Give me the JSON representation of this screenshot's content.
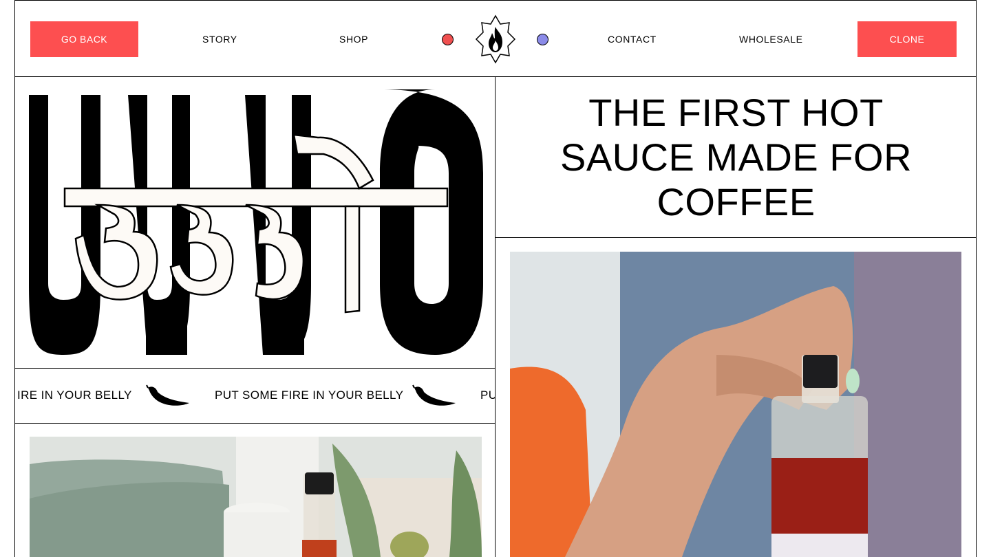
{
  "nav": {
    "back_label": "GO BACK",
    "story_label": "STORY",
    "shop_label": "SHOP",
    "contact_label": "CONTACT",
    "wholesale_label": "WHOLESALE",
    "clone_label": "CLONE",
    "logo_icon": "flame-star-icon",
    "dot_left_color": "#f05050",
    "dot_right_color": "#8b8be8"
  },
  "brand": {
    "accent_color": "#fd4f50"
  },
  "marquee": {
    "items": [
      "IRE IN YOUR BELLY",
      "PUT SOME FIRE IN YOUR BELLY",
      "PU"
    ],
    "separator_icon": "chili-pepper-icon"
  },
  "hero": {
    "headline": "THE FIRST HOT SAUCE MADE FOR COFFEE"
  }
}
